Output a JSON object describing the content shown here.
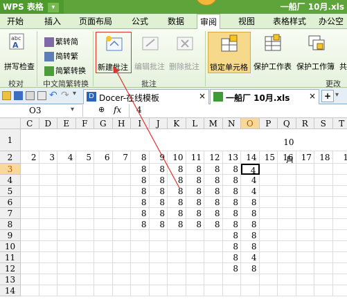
{
  "app": {
    "name": "WPS 表格",
    "dropdown_glyph": "▾",
    "document_title": "一船厂 10月.xls"
  },
  "menu": {
    "items": [
      "开始",
      "插入",
      "页面布局",
      "公式",
      "数据",
      "审阅",
      "视图",
      "表格样式",
      "办公空"
    ],
    "active": "审阅"
  },
  "ribbon": {
    "spell_check": "拼写检查",
    "trad_simp": {
      "to_trad": "繁转简",
      "to_simp": "简转繁",
      "convert": "简繁转换"
    },
    "new_comment": "新建批注",
    "edit_comment": "编辑批注",
    "delete_comment": "删除批注",
    "lock_cell": "锁定单元格",
    "protect_sheet": "保护工作表",
    "protect_workbook": "保护工作簿",
    "share": "共",
    "groups": {
      "proofing": "校对",
      "chinese": "中文简繁转换",
      "comments": "批注",
      "changes": "更改"
    }
  },
  "tabs": [
    {
      "label": "Docer-在线模板",
      "close": "×"
    },
    {
      "label": "一船厂 10月.xls",
      "close": "×"
    }
  ],
  "new_tab": "+",
  "formula_bar": {
    "cell_ref": "O3",
    "dropdown": "▾",
    "zoom_icon": "⊕",
    "fx": "fx",
    "value": "4"
  },
  "columns": [
    "C",
    "D",
    "E",
    "F",
    "G",
    "H",
    "I",
    "J",
    "K",
    "L",
    "M",
    "N",
    "O",
    "P",
    "Q",
    "R",
    "S",
    "T"
  ],
  "rows": [
    {
      "n": "1",
      "cells": {
        "Q": "10月"
      }
    },
    {
      "n": "2",
      "cells": {
        "C": "2",
        "D": "3",
        "E": "4",
        "F": "5",
        "G": "6",
        "H": "7",
        "I": "8",
        "J": "9",
        "K": "10",
        "L": "11",
        "M": "12",
        "N": "13",
        "O": "14",
        "P": "15",
        "Q": "16",
        "R": "17",
        "S": "18",
        "T": "1"
      }
    },
    {
      "n": "3",
      "cells": {
        "I": "8",
        "J": "8",
        "K": "8",
        "L": "8",
        "M": "8",
        "N": "8",
        "O": "4"
      }
    },
    {
      "n": "4",
      "cells": {
        "I": "8",
        "J": "8",
        "K": "8",
        "L": "8",
        "M": "8",
        "N": "8",
        "O": "4"
      }
    },
    {
      "n": "5",
      "cells": {
        "I": "8",
        "J": "8",
        "K": "8",
        "L": "8",
        "M": "8",
        "N": "8",
        "O": "4"
      }
    },
    {
      "n": "6",
      "cells": {
        "I": "8",
        "J": "8",
        "K": "8",
        "L": "8",
        "M": "8",
        "N": "8",
        "O": "8"
      }
    },
    {
      "n": "7",
      "cells": {
        "I": "8",
        "J": "8",
        "K": "8",
        "L": "8",
        "M": "8",
        "N": "8",
        "O": "8"
      }
    },
    {
      "n": "8",
      "cells": {
        "I": "8",
        "J": "8",
        "K": "8",
        "L": "8",
        "M": "8",
        "N": "8",
        "O": "8"
      }
    },
    {
      "n": "9",
      "cells": {
        "N": "8",
        "O": "8"
      }
    },
    {
      "n": "10",
      "cells": {
        "N": "8",
        "O": "8"
      }
    },
    {
      "n": "11",
      "cells": {
        "N": "8",
        "O": "4"
      }
    },
    {
      "n": "12",
      "cells": {
        "N": "8",
        "O": "8"
      }
    },
    {
      "n": "13",
      "cells": {}
    },
    {
      "n": "14",
      "cells": {}
    }
  ],
  "selected_cell": "O3",
  "colors": {
    "title_green": "#5fa33b",
    "highlight_red": "#e0322c",
    "locked_cell_bg": "#f7d98b"
  }
}
